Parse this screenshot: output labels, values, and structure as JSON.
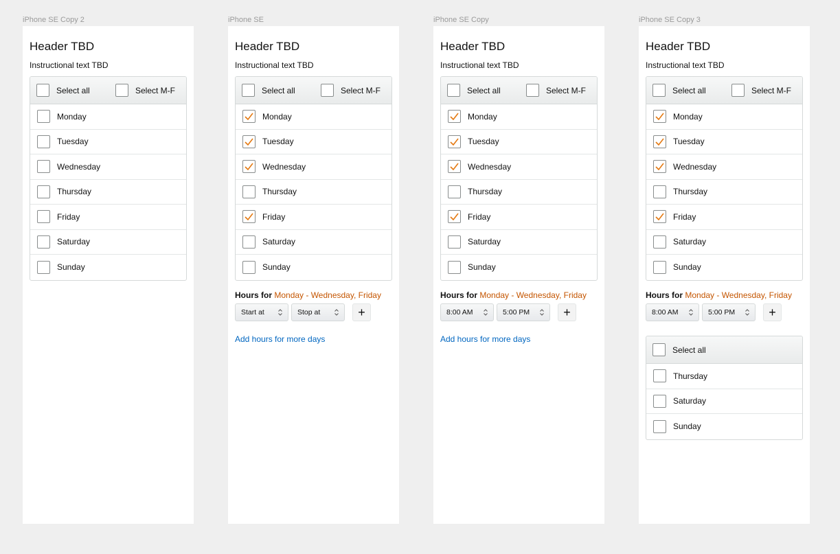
{
  "frames": [
    {
      "label": "iPhone SE Copy 2",
      "header": "Header TBD",
      "instruction": "Instructional text TBD",
      "select_all": "Select all",
      "select_mf": "Select M-F",
      "days": [
        {
          "label": "Monday",
          "checked": false
        },
        {
          "label": "Tuesday",
          "checked": false
        },
        {
          "label": "Wednesday",
          "checked": false
        },
        {
          "label": "Thursday",
          "checked": false
        },
        {
          "label": "Friday",
          "checked": false
        },
        {
          "label": "Saturday",
          "checked": false
        },
        {
          "label": "Sunday",
          "checked": false
        }
      ]
    },
    {
      "label": "iPhone SE",
      "header": "Header TBD",
      "instruction": "Instructional text TBD",
      "select_all": "Select all",
      "select_mf": "Select M-F",
      "days": [
        {
          "label": "Monday",
          "checked": true
        },
        {
          "label": "Tuesday",
          "checked": true
        },
        {
          "label": "Wednesday",
          "checked": true
        },
        {
          "label": "Thursday",
          "checked": false
        },
        {
          "label": "Friday",
          "checked": true
        },
        {
          "label": "Saturday",
          "checked": false
        },
        {
          "label": "Sunday",
          "checked": false
        }
      ],
      "hours_for_label": "Hours for",
      "hours_days": "Monday - Wednesday, Friday",
      "start_value": "Start at",
      "stop_value": "Stop at",
      "add_icon": "plus-icon",
      "add_more_link": "Add hours for more days"
    },
    {
      "label": "iPhone SE Copy",
      "header": "Header TBD",
      "instruction": "Instructional text TBD",
      "select_all": "Select all",
      "select_mf": "Select M-F",
      "days": [
        {
          "label": "Monday",
          "checked": true
        },
        {
          "label": "Tuesday",
          "checked": true
        },
        {
          "label": "Wednesday",
          "checked": true
        },
        {
          "label": "Thursday",
          "checked": false
        },
        {
          "label": "Friday",
          "checked": true
        },
        {
          "label": "Saturday",
          "checked": false
        },
        {
          "label": "Sunday",
          "checked": false
        }
      ],
      "hours_for_label": "Hours for",
      "hours_days": "Monday - Wednesday, Friday",
      "start_value": "8:00 AM",
      "stop_value": "5:00 PM",
      "add_icon": "plus-icon",
      "add_more_link": "Add hours for more days"
    },
    {
      "label": "iPhone SE Copy 3",
      "header": "Header TBD",
      "instruction": "Instructional text TBD",
      "select_all": "Select all",
      "select_mf": "Select M-F",
      "days": [
        {
          "label": "Monday",
          "checked": true
        },
        {
          "label": "Tuesday",
          "checked": true
        },
        {
          "label": "Wednesday",
          "checked": true
        },
        {
          "label": "Thursday",
          "checked": false
        },
        {
          "label": "Friday",
          "checked": true
        },
        {
          "label": "Saturday",
          "checked": false
        },
        {
          "label": "Sunday",
          "checked": false
        }
      ],
      "hours_for_label": "Hours for",
      "hours_days": "Monday - Wednesday, Friday",
      "start_value": "8:00 AM",
      "stop_value": "5:00 PM",
      "add_icon": "plus-icon",
      "remaining": {
        "select_all": "Select all",
        "days": [
          {
            "label": "Thursday",
            "checked": false
          },
          {
            "label": "Saturday",
            "checked": false
          },
          {
            "label": "Sunday",
            "checked": false
          }
        ]
      }
    }
  ],
  "colors": {
    "accent_orange": "#c45500",
    "checkmark": "#e47911",
    "link_blue": "#0066c0",
    "background": "#efefef"
  }
}
